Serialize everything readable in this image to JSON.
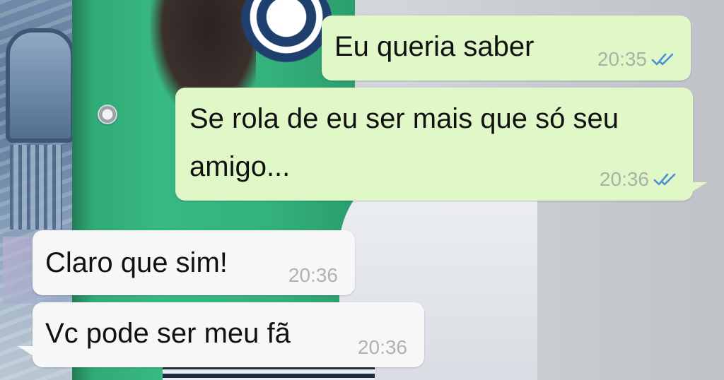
{
  "chat": {
    "messages": [
      {
        "direction": "outgoing",
        "text": "Eu queria saber",
        "time": "20:35",
        "status_icon": "double-check-icon"
      },
      {
        "direction": "outgoing",
        "line1": "Se rola de eu ser mais que só seu",
        "line2": "amigo...",
        "time": "20:36",
        "status_icon": "double-check-icon"
      },
      {
        "direction": "incoming",
        "text": "Claro que sim!",
        "time": "20:36"
      },
      {
        "direction": "incoming",
        "text": "Vc pode ser meu fã",
        "time": "20:36"
      }
    ]
  },
  "colors": {
    "outgoing_bubble": "#e0f7c7",
    "incoming_bubble": "#f7f7f7",
    "read_check": "#4a90d9",
    "jacket": "#34b27d"
  }
}
